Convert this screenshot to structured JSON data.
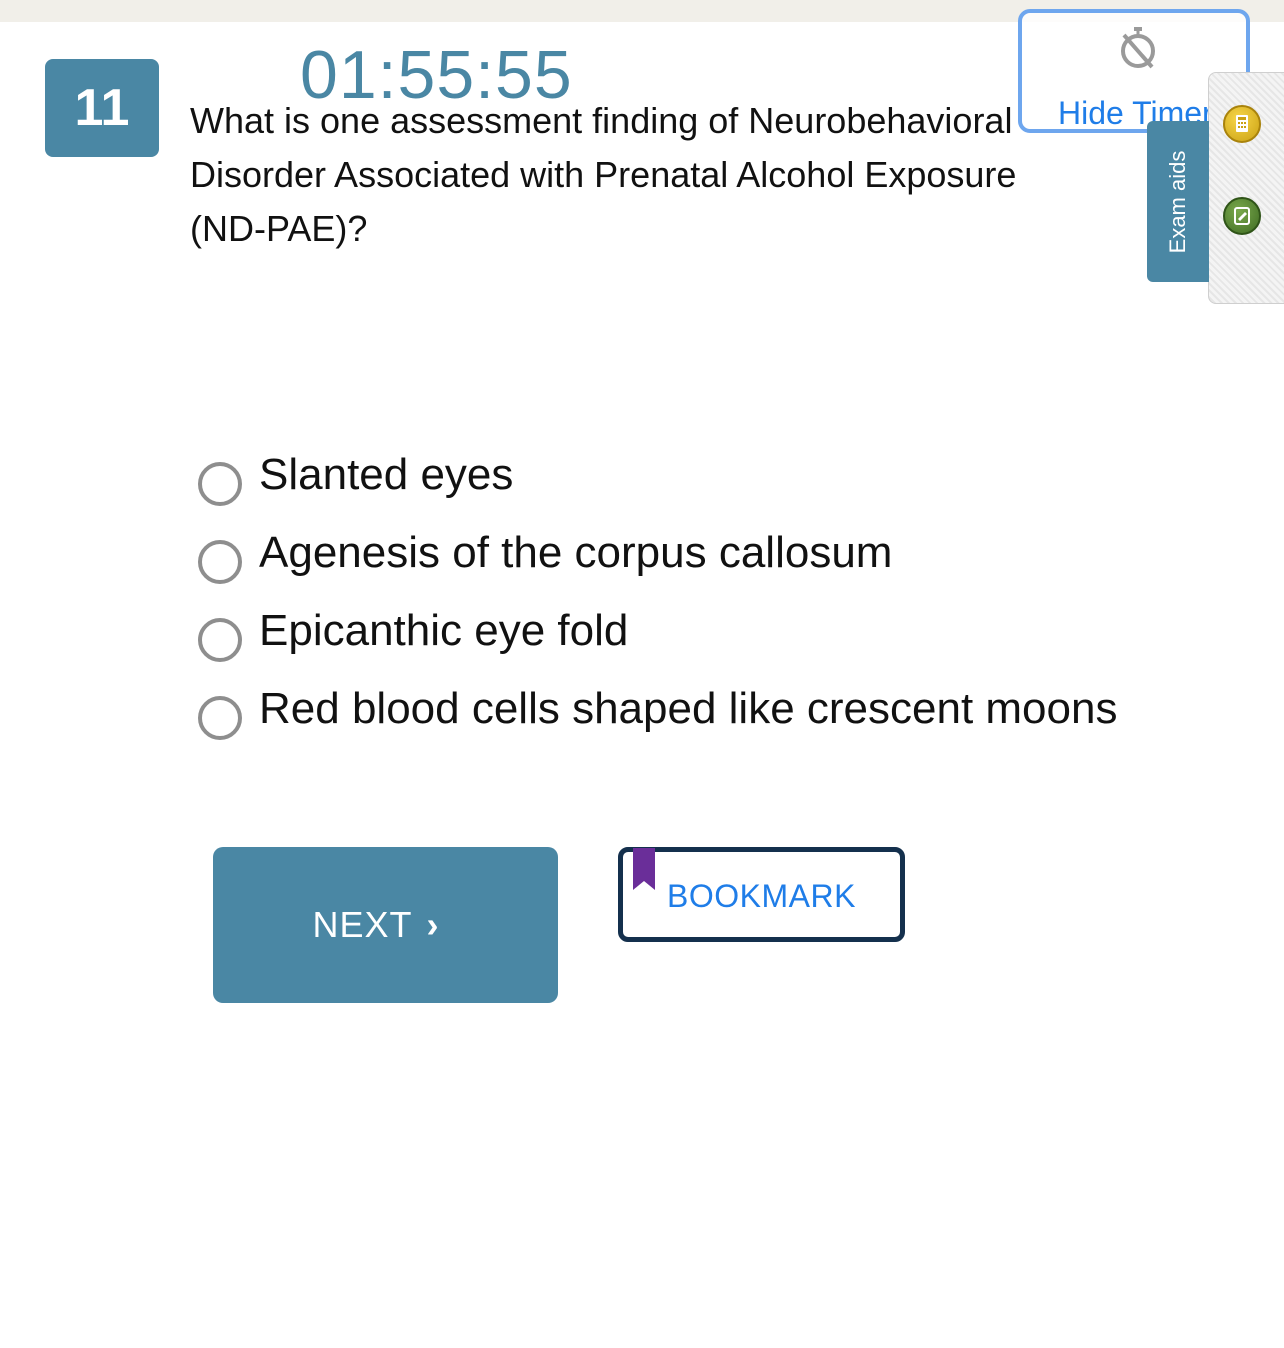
{
  "question": {
    "number": "11",
    "text": "What is one assessment finding of Neurobehavioral Disorder Associated with Prenatal Alcohol Exposure (ND-PAE)?"
  },
  "timer": {
    "value": "01:55:55",
    "hide_label": "Hide Timer"
  },
  "exam_aids": {
    "label": "Exam aids",
    "icons": [
      "calculator-icon",
      "notes-icon"
    ]
  },
  "options": [
    {
      "label": "Slanted eyes",
      "selected": false
    },
    {
      "label": "Agenesis of the corpus callosum",
      "selected": false
    },
    {
      "label": "Epicanthic eye fold",
      "selected": false
    },
    {
      "label": "Red blood cells shaped like crescent moons",
      "selected": false
    }
  ],
  "actions": {
    "next_label": "NEXT",
    "next_chevron": "›",
    "bookmark_label": "BOOKMARK"
  },
  "colors": {
    "primary": "#4a87a4",
    "link_blue": "#1f7de8",
    "bookmark_border": "#14304d",
    "bookmark_ribbon": "#6a2e99"
  }
}
